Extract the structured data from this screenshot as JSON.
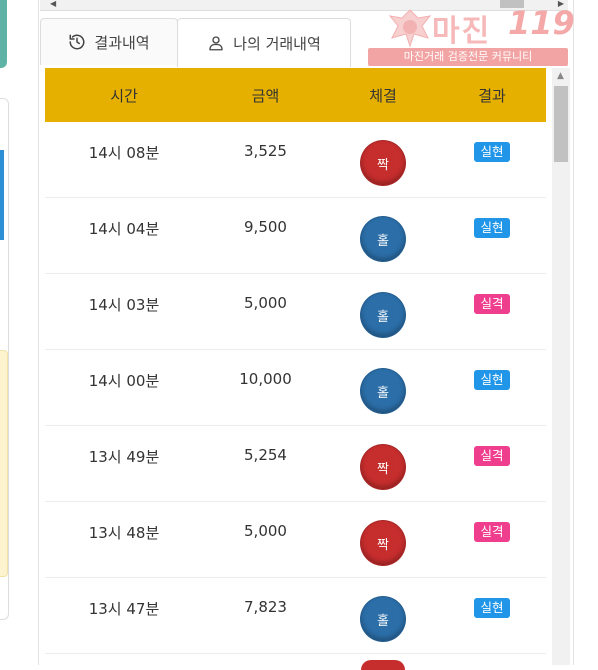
{
  "tabs": {
    "result_history": "결과내역",
    "my_trades": "나의 거래내역"
  },
  "logo": {
    "name": "마진",
    "number": "119",
    "tagline": "마진거래 검증전문 커뮤니티"
  },
  "table": {
    "headers": [
      "시간",
      "금액",
      "체결",
      "결과"
    ],
    "rows": [
      {
        "time": "14시 08분",
        "amount": "3,525",
        "fill": "짝",
        "result": "실현"
      },
      {
        "time": "14시 04분",
        "amount": "9,500",
        "fill": "홀",
        "result": "실현"
      },
      {
        "time": "14시 03분",
        "amount": "5,000",
        "fill": "홀",
        "result": "실격"
      },
      {
        "time": "14시 00분",
        "amount": "10,000",
        "fill": "홀",
        "result": "실현"
      },
      {
        "time": "13시 49분",
        "amount": "5,254",
        "fill": "짝",
        "result": "실격"
      },
      {
        "time": "13시 48분",
        "amount": "5,000",
        "fill": "짝",
        "result": "실격"
      },
      {
        "time": "13시 47분",
        "amount": "7,823",
        "fill": "홀",
        "result": "실현"
      }
    ]
  },
  "colors": {
    "header_bg": "#e6b000",
    "even_ball": "#c62d2d",
    "odd_ball": "#2b6ea8",
    "win_badge": "#2196e8",
    "lose_badge": "#ef3e8e"
  },
  "icons": {
    "tab1": "history-icon",
    "tab2": "user-icon"
  }
}
